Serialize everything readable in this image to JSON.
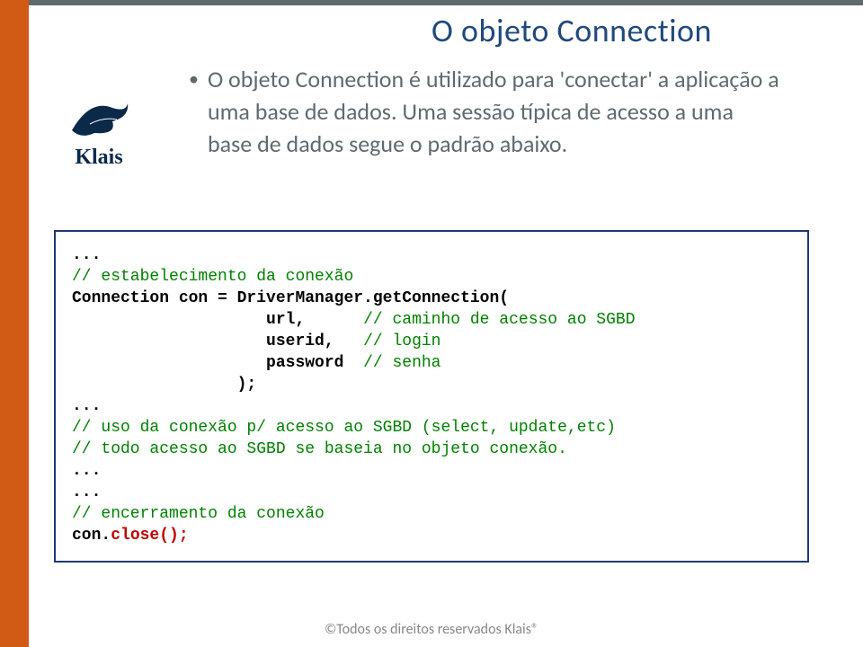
{
  "title": "O objeto Connection",
  "bullet": {
    "line1": "O objeto Connection é utilizado para 'conectar' a aplicação a uma base de dados. Uma sessão típica de acesso a uma base de dados segue o padrão abaixo."
  },
  "code": {
    "l1": "...",
    "l2": "// estabelecimento da conexão",
    "l3a": "Connection con = DriverManager.getConnection(",
    "l4a": "                    url,      ",
    "l4b": "// caminho de acesso ao SGBD",
    "l5a": "                    userid,   ",
    "l5b": "// login",
    "l6a": "                    password  ",
    "l6b": "// senha",
    "l7": "                 );",
    "l8": "...",
    "l9": "// uso da conexão p/ acesso ao SGBD (select, update,etc)",
    "l10": "// todo acesso ao SGBD se baseia no objeto conexão.",
    "l11": "...",
    "l12": "...",
    "l13": "// encerramento da conexão",
    "l14a": "con.",
    "l14b": "close();"
  },
  "logo": {
    "name": "Klais"
  },
  "footer": "©Todos os direitos reservados Klais®"
}
